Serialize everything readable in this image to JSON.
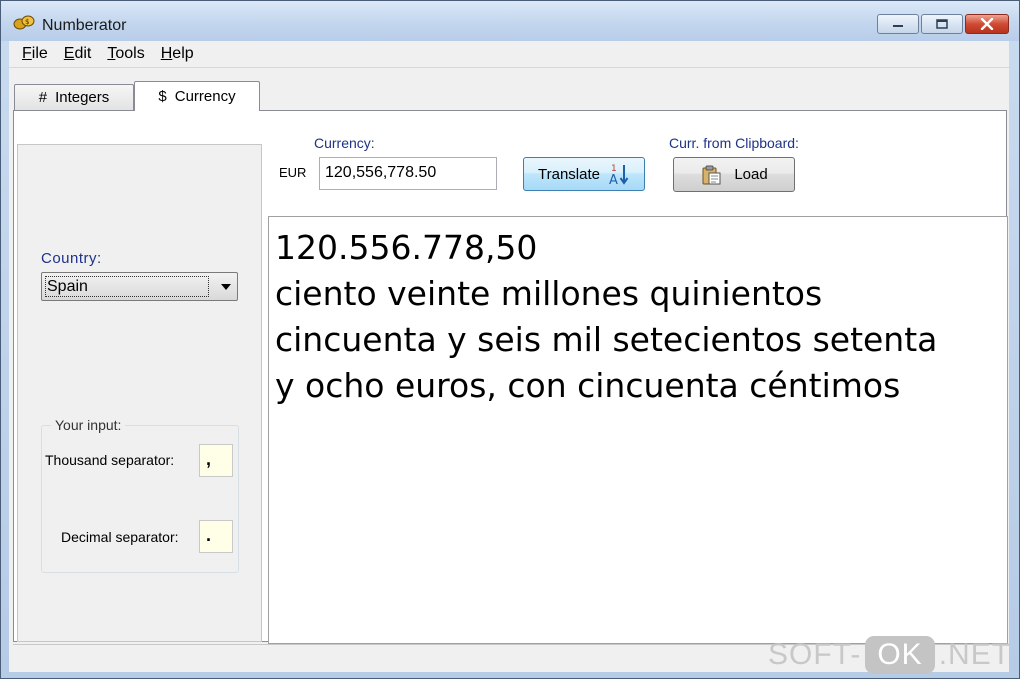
{
  "window": {
    "title": "Numberator",
    "icons": {
      "app": "numberator-app-icon",
      "minimize": "minimize-icon",
      "maximize": "maximize-icon",
      "close": "close-icon"
    }
  },
  "menu": {
    "items": [
      {
        "mnemonic": "F",
        "rest": "ile"
      },
      {
        "mnemonic": "E",
        "rest": "dit"
      },
      {
        "mnemonic": "T",
        "rest": "ools"
      },
      {
        "mnemonic": "H",
        "rest": "elp"
      }
    ]
  },
  "tabs": [
    {
      "symbol": "#",
      "label": "Integers"
    },
    {
      "symbol": "$",
      "label": "Currency"
    }
  ],
  "country": {
    "label": "Country:",
    "selected": "Spain"
  },
  "your_input": {
    "legend": "Your input:",
    "thousand_label": "Thousand separator:",
    "thousand_value": ",",
    "decimal_label": "Decimal separator:",
    "decimal_value": "."
  },
  "currency": {
    "label": "Currency:",
    "code": "EUR",
    "value": "120,556,778.50"
  },
  "translate_button": {
    "label": "Translate",
    "icon": "sort-1-a-icon"
  },
  "clipboard": {
    "label": "Curr. from Clipboard:",
    "load_label": "Load",
    "icon": "clipboard-icon"
  },
  "output": {
    "lines": [
      "120.556.778,50",
      "ciento veinte millones quinientos",
      "cincuenta y seis mil setecientos setenta",
      "y ocho euros, con cincuenta céntimos"
    ]
  },
  "watermark": {
    "left": "SOFT-",
    "pill": "OK",
    "right": ".NET"
  },
  "colors": {
    "label_blue": "#1e3287",
    "separator_bg": "#ffffe8",
    "close_red": "#cf4b34"
  }
}
